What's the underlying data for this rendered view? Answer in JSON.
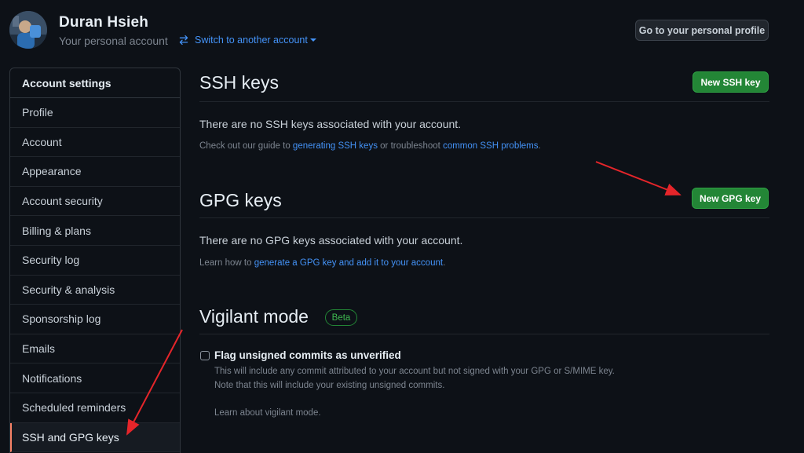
{
  "header": {
    "user_name": "Duran Hsieh",
    "account_type": "Your personal account",
    "switch_label": "Switch to another account",
    "profile_button": "Go to your personal profile"
  },
  "sidebar": {
    "heading": "Account settings",
    "items": [
      {
        "label": "Profile"
      },
      {
        "label": "Account"
      },
      {
        "label": "Appearance"
      },
      {
        "label": "Account security"
      },
      {
        "label": "Billing & plans"
      },
      {
        "label": "Security log"
      },
      {
        "label": "Security & analysis"
      },
      {
        "label": "Sponsorship log"
      },
      {
        "label": "Emails"
      },
      {
        "label": "Notifications"
      },
      {
        "label": "Scheduled reminders"
      },
      {
        "label": "SSH and GPG keys"
      }
    ],
    "active_item": "SSH and GPG keys"
  },
  "ssh": {
    "title": "SSH keys",
    "new_button": "New SSH key",
    "empty_text": "There are no SSH keys associated with your account.",
    "guide_prefix": "Check out our guide to ",
    "guide_link": "generating SSH keys",
    "guide_middle": " or troubleshoot ",
    "troubleshoot_link": "common SSH problems",
    "guide_suffix": "."
  },
  "gpg": {
    "title": "GPG keys",
    "new_button": "New GPG key",
    "empty_text": "There are no GPG keys associated with your account.",
    "learn_prefix": "Learn how to ",
    "learn_link": "generate a GPG key and add it to your account",
    "learn_suffix": "."
  },
  "vigilant": {
    "title": "Vigilant mode",
    "badge": "Beta",
    "checkbox_label": "Flag unsigned commits as unverified",
    "checked": false,
    "note_line1": "This will include any commit attributed to your account but not signed with your GPG or S/MIME key.",
    "note_line2": "Note that this will include your existing unsigned commits.",
    "learn_link": "Learn about vigilant mode."
  },
  "colors": {
    "background": "#0d1117",
    "link": "#4493f8",
    "primary_button": "#238636",
    "annotation_arrow": "#e5252a"
  },
  "icons": [
    "avatar-image",
    "switch-arrows-icon",
    "caret-down-icon",
    "checkbox-icon"
  ]
}
